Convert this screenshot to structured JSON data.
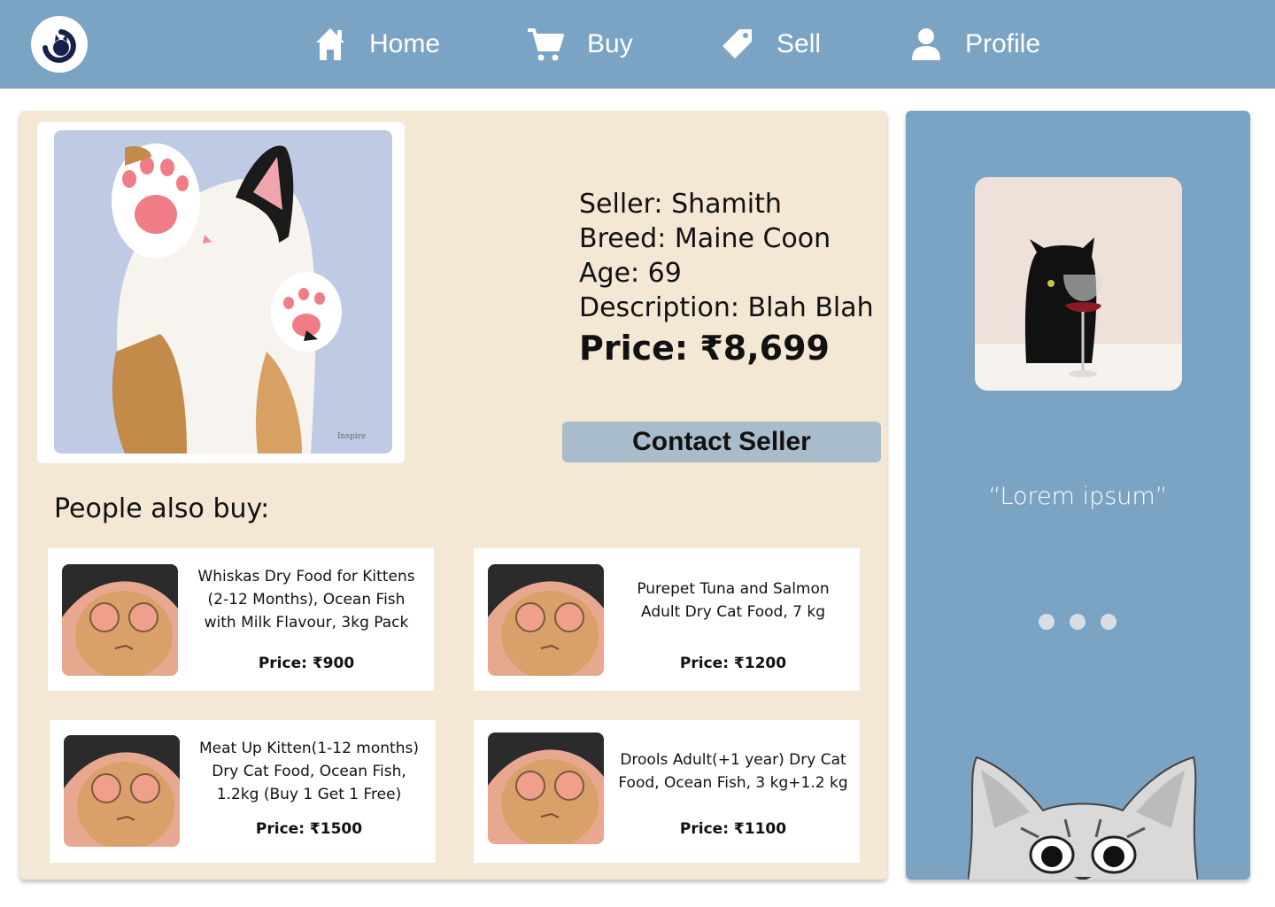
{
  "nav": {
    "items": [
      {
        "label": "Home",
        "icon": "home-icon"
      },
      {
        "label": "Buy",
        "icon": "cart-icon"
      },
      {
        "label": "Sell",
        "icon": "tag-icon"
      },
      {
        "label": "Profile",
        "icon": "user-icon"
      }
    ]
  },
  "listing": {
    "seller": "Seller: Shamith",
    "breed": "Breed: Maine Coon",
    "age": "Age: 69",
    "description": "Description: Blah Blah",
    "price": "Price: ₹8,699",
    "contact_label": "Contact Seller"
  },
  "recommendations": {
    "title": "People also buy:",
    "items": [
      {
        "name": "Whiskas Dry Food for Kittens (2-12 Months), Ocean Fish with Milk Flavour, 3kg Pack",
        "price": "Price: ₹900"
      },
      {
        "name": "Purepet Tuna and Salmon Adult Dry Cat Food, 7 kg",
        "price": "Price: ₹1200"
      },
      {
        "name": "Meat Up Kitten(1-12 months) Dry Cat Food, Ocean Fish, 1.2kg (Buy 1 Get 1 Free)",
        "price": "Price: ₹1500"
      },
      {
        "name": "Drools Adult(+1 year) Dry Cat Food, Ocean Fish, 3 kg+1.2 kg",
        "price": "Price: ₹1100"
      }
    ]
  },
  "sidebar": {
    "quote": "“Lorem ipsum”"
  },
  "colors": {
    "nav_bg": "#7ba3c4",
    "panel_bg": "#f4e7d4",
    "button_bg": "#a9bccb"
  }
}
